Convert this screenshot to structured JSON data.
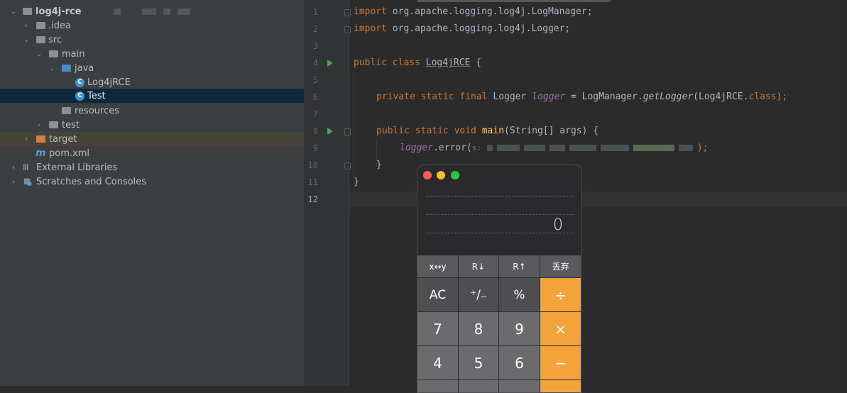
{
  "project_tree": {
    "root": {
      "label": "log4j-rce"
    },
    "items": [
      {
        "label": ".idea"
      },
      {
        "label": "src"
      },
      {
        "label": "main"
      },
      {
        "label": "java"
      },
      {
        "label": "Log4jRCE"
      },
      {
        "label": "Test"
      },
      {
        "label": "resources"
      },
      {
        "label": "test"
      },
      {
        "label": "target"
      },
      {
        "label": "pom.xml"
      },
      {
        "label": "External Libraries"
      },
      {
        "label": "Scratches and Consoles"
      }
    ]
  },
  "editor": {
    "line_numbers": [
      "1",
      "2",
      "3",
      "4",
      "5",
      "6",
      "7",
      "8",
      "9",
      "10",
      "11",
      "12"
    ],
    "lines": {
      "l1": {
        "kw": "import",
        "rest": " org.apache.logging.log4j.LogManager;"
      },
      "l2": {
        "kw": "import",
        "rest": " org.apache.logging.log4j.Logger;"
      },
      "l4": {
        "kw": "public class",
        "name": "Log4jRCE",
        "rest": " {"
      },
      "l6": {
        "kw": "private static final",
        "type": " Logger ",
        "field": "logger",
        "mid": " = LogManager.",
        "method": "getLogger",
        "rest": "(Log4jRCE.",
        "kw2": "class",
        "end": ");"
      },
      "l8": {
        "kw": "public static void",
        "name": "main",
        "rest": "(String[] args) {"
      },
      "l9": {
        "field": "logger",
        "call": ".error(",
        "param_hint": "s:",
        "end": ");"
      },
      "l10": {
        "text": "}"
      },
      "l11": {
        "text": "}"
      }
    }
  },
  "calculator": {
    "display_value": "0",
    "traffic_light_colors": {
      "close": "#ff5f57",
      "minimize": "#febc2e",
      "zoom": "#28c840"
    },
    "function_row": [
      "x↔y",
      "R↓",
      "R↑",
      "丢弃"
    ],
    "keys_row1": [
      "AC",
      "⁺∕₋",
      "%",
      "÷"
    ],
    "keys_row2": [
      "7",
      "8",
      "9",
      "×"
    ],
    "keys_row3": [
      "4",
      "5",
      "6",
      "−"
    ]
  }
}
